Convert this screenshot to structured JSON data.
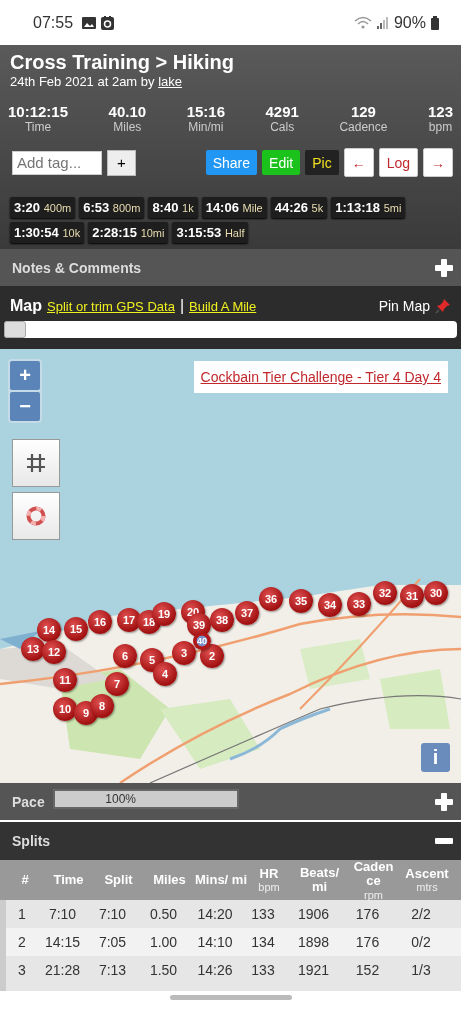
{
  "status_bar": {
    "time": "07:55",
    "battery": "90%"
  },
  "header": {
    "title": "Cross Training > Hiking",
    "subtitle": "24th Feb 2021 at 2am by ",
    "author": "lake"
  },
  "stats": [
    {
      "value": "10:12:15",
      "label": "Time"
    },
    {
      "value": "40.10",
      "label": "Miles"
    },
    {
      "value": "15:16",
      "label": "Min/mi"
    },
    {
      "value": "4291",
      "label": "Cals"
    },
    {
      "value": "129",
      "label": "Cadence"
    },
    {
      "value": "123",
      "label": "bpm"
    }
  ],
  "tag_field": {
    "placeholder": "Add tag...",
    "add_button": "+"
  },
  "actions": [
    {
      "label": "Share",
      "kind": "blue"
    },
    {
      "label": "Edit",
      "kind": "green"
    },
    {
      "label": "Pic",
      "kind": "dark"
    },
    {
      "label": "←",
      "kind": "light"
    },
    {
      "label": "Log",
      "kind": "light"
    },
    {
      "label": "→",
      "kind": "light"
    }
  ],
  "bests": [
    {
      "time": "3:20",
      "distance": "400m"
    },
    {
      "time": "6:53",
      "distance": "800m"
    },
    {
      "time": "8:40",
      "distance": "1k"
    },
    {
      "time": "14:06",
      "distance": "Mile"
    },
    {
      "time": "44:26",
      "distance": "5k"
    },
    {
      "time": "1:13:18",
      "distance": "5mi"
    },
    {
      "time": "1:30:54",
      "distance": "10k"
    },
    {
      "time": "2:28:15",
      "distance": "10mi"
    },
    {
      "time": "3:15:53",
      "distance": "Half"
    }
  ],
  "notes": {
    "title": "Notes & Comments",
    "expanded": false
  },
  "map_bar": {
    "title": "Map",
    "links": [
      "Split or trim GPS Data",
      "Build A Mile"
    ],
    "separator": "|",
    "pin": "Pin Map",
    "slider": {
      "level": 0
    }
  },
  "map": {
    "zoom_in": "+",
    "zoom_out": "−",
    "route_link": "Cockbain Tier Challenge - Tier 4 Day 4",
    "info": "i",
    "markers": [
      {
        "label": "13",
        "kind": "split"
      },
      {
        "label": "14",
        "kind": "split"
      },
      {
        "label": "12",
        "kind": "split"
      },
      {
        "label": "11",
        "kind": "split"
      },
      {
        "label": "10",
        "kind": "split"
      },
      {
        "label": "15",
        "kind": "split"
      },
      {
        "label": "9",
        "kind": "split"
      },
      {
        "label": "16",
        "kind": "split"
      },
      {
        "label": "8",
        "kind": "split"
      },
      {
        "label": "7",
        "kind": "split"
      },
      {
        "label": "6",
        "kind": "split"
      },
      {
        "label": "17",
        "kind": "split"
      },
      {
        "label": "18",
        "kind": "split"
      },
      {
        "label": "5",
        "kind": "split"
      },
      {
        "label": "19",
        "kind": "split"
      },
      {
        "label": "4",
        "kind": "split"
      },
      {
        "label": "3",
        "kind": "split"
      },
      {
        "label": "20",
        "kind": "split"
      },
      {
        "label": "39",
        "kind": "split"
      },
      {
        "label": "40",
        "kind": "end"
      },
      {
        "label": "2",
        "kind": "split"
      },
      {
        "label": "38",
        "kind": "split"
      },
      {
        "label": "37",
        "kind": "split"
      },
      {
        "label": "36",
        "kind": "split"
      },
      {
        "label": "35",
        "kind": "split"
      },
      {
        "label": "34",
        "kind": "split"
      },
      {
        "label": "33",
        "kind": "split"
      },
      {
        "label": "32",
        "kind": "split"
      },
      {
        "label": "31",
        "kind": "split"
      },
      {
        "label": "30",
        "kind": "split"
      }
    ]
  },
  "pace": {
    "title": "Pace",
    "level": 1,
    "reading": "100%",
    "expanded": false
  },
  "splits": {
    "title": "Splits",
    "expanded": true,
    "columns": [
      {
        "label": "#"
      },
      {
        "label": "Time"
      },
      {
        "label": "Split"
      },
      {
        "label": "Miles"
      },
      {
        "label": "Mins/ mi"
      },
      {
        "label": "HR",
        "unit": "bpm"
      },
      {
        "label": "Beats/ mi"
      },
      {
        "label": "Caden ce",
        "unit": "rpm"
      },
      {
        "label": "Ascent",
        "unit": "mtrs"
      }
    ],
    "rows": [
      [
        "1",
        "7:10",
        "7:10",
        "0.50",
        "14:20",
        "133",
        "1906",
        "176",
        "2/2"
      ],
      [
        "2",
        "14:15",
        "7:05",
        "1.00",
        "14:10",
        "134",
        "1898",
        "176",
        "0/2"
      ],
      [
        "3",
        "21:28",
        "7:13",
        "1.50",
        "14:26",
        "133",
        "1921",
        "152",
        "1/3"
      ]
    ]
  }
}
